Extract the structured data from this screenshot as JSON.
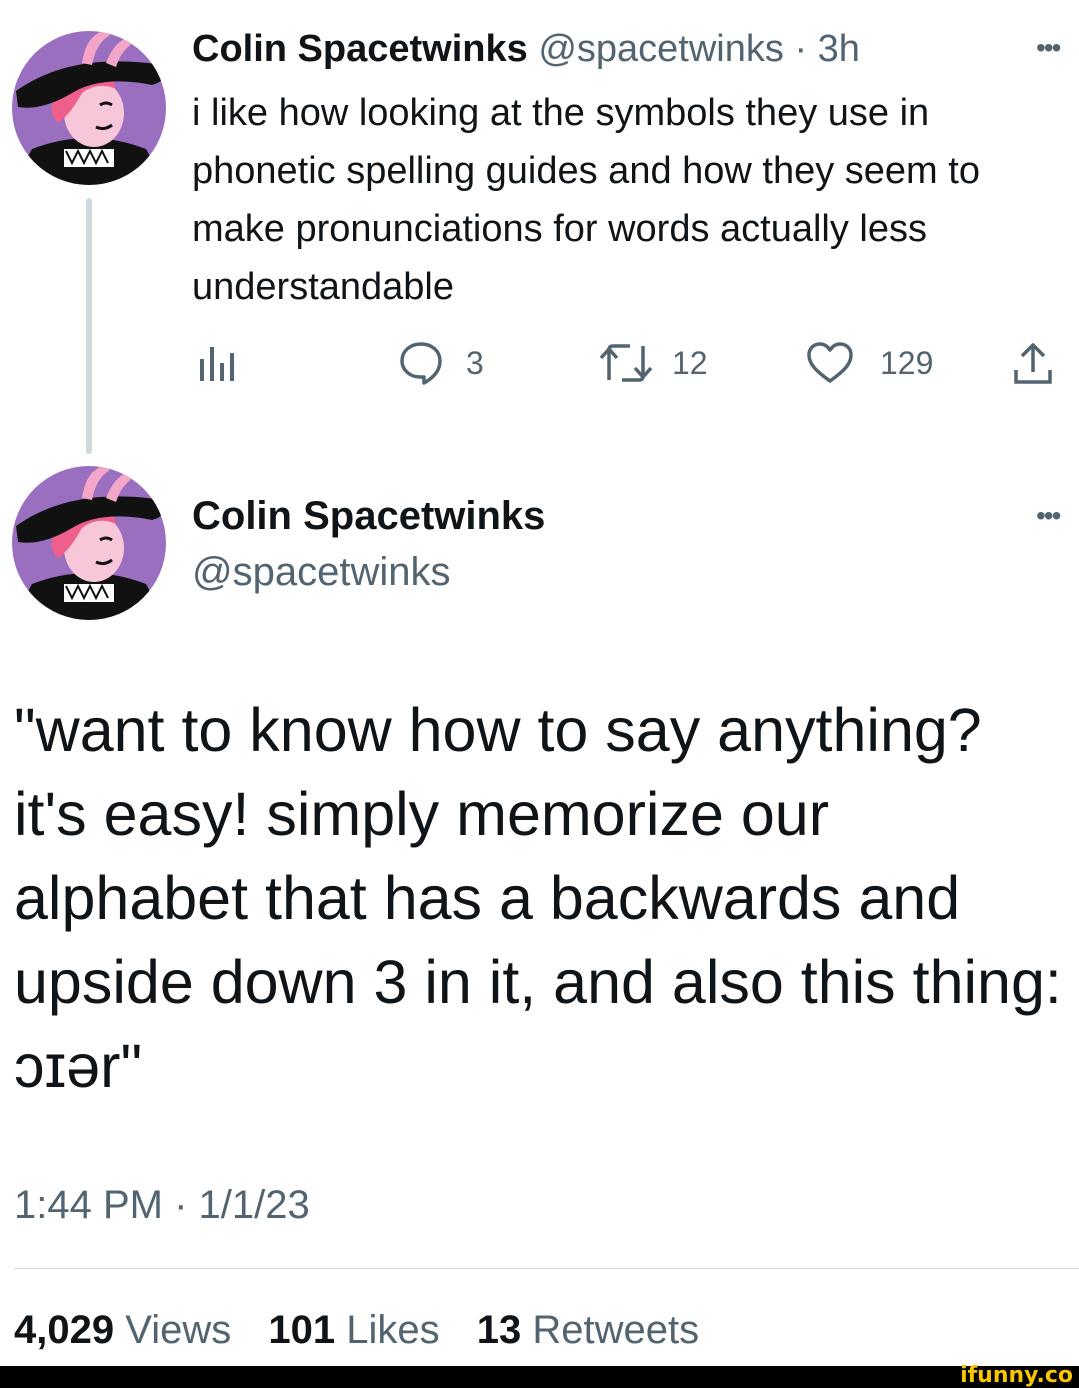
{
  "tweet1": {
    "name": "Colin Spacetwinks",
    "handle": "@spacetwinks",
    "separator": "·",
    "time": "3h",
    "text": "i like how looking at the symbols they use in phonetic spelling guides and how they seem to make pronunciations for words actually less understandable",
    "more": "•••",
    "actions": {
      "replies": "3",
      "retweets": "12",
      "likes": "129"
    }
  },
  "tweet2": {
    "name": "Colin Spacetwinks",
    "handle": "@spacetwinks",
    "more": "•••",
    "text": "\"want to know how to say anything? it's easy! simply memorize our alphabet that has a backwards and upside down 3 in it, and also this thing: ɔɪər\"",
    "timestamp": "1:44 PM · 1/1/23",
    "stats": {
      "views_count": "4,029",
      "views_label": "Views",
      "likes_count": "101",
      "likes_label": "Likes",
      "retweets_count": "13",
      "retweets_label": "Retweets"
    }
  },
  "watermark": "ifunny.co",
  "colors": {
    "text": "#0f1419",
    "muted": "#536471",
    "thread_line": "#cfd9de",
    "avatar_bg": "#9b6fc0",
    "watermark": "#f7c600"
  },
  "icons": [
    "analytics-icon",
    "reply-icon",
    "retweet-icon",
    "like-icon",
    "share-icon",
    "more-icon",
    "avatar"
  ]
}
